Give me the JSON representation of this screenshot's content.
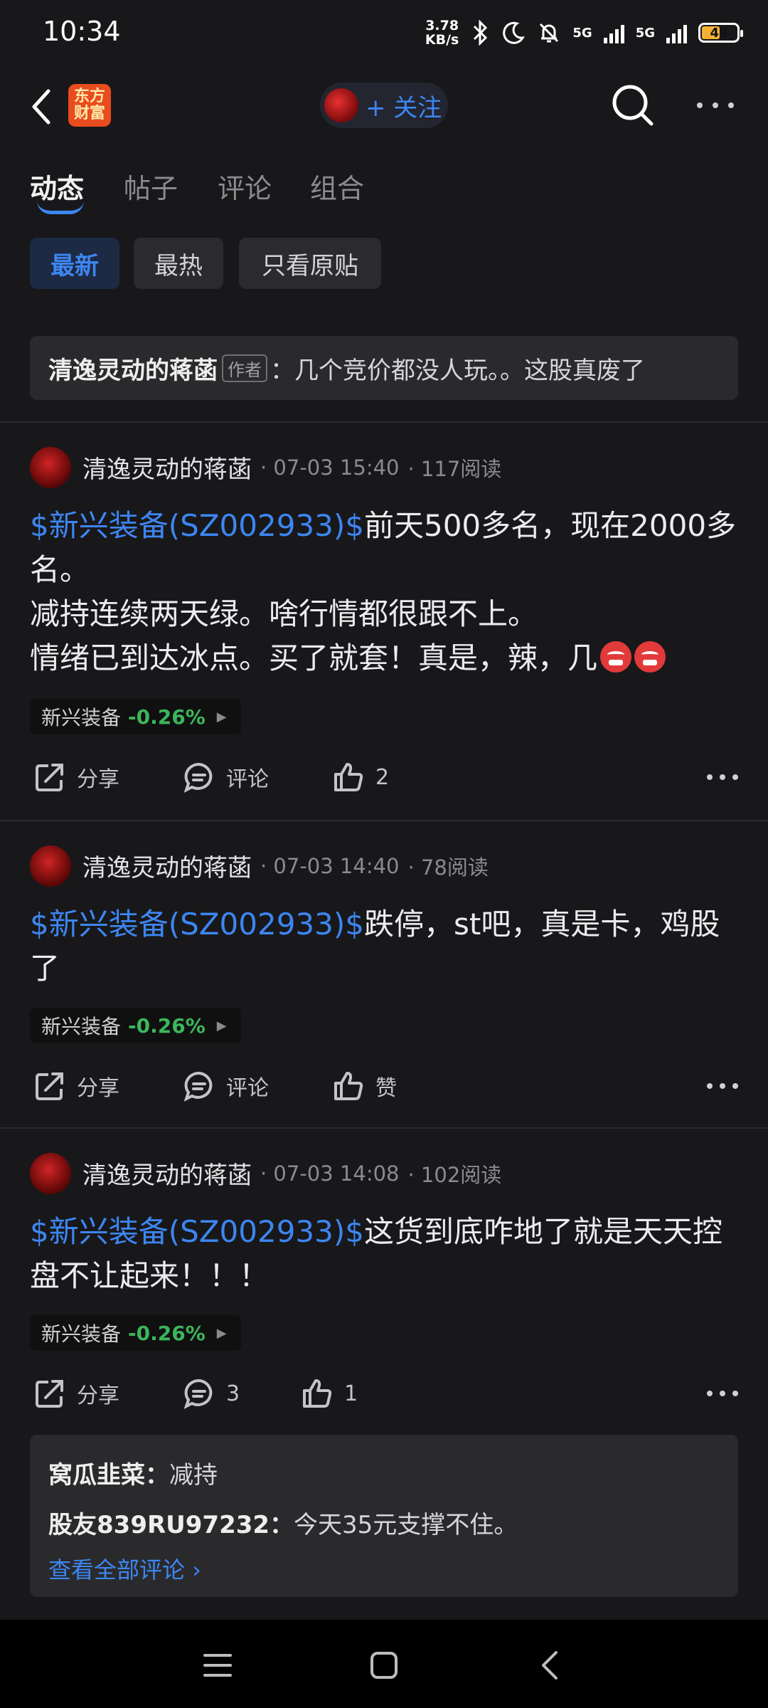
{
  "status_bar": {
    "time": "10:34",
    "net_speed_value": "3.78",
    "net_speed_unit": "KB/s",
    "network_1": "5G",
    "network_2": "5G",
    "battery": "49"
  },
  "header": {
    "logo_text": "东方财富",
    "follow_label": "+ 关注"
  },
  "tabs": [
    {
      "label": "动态",
      "active": true
    },
    {
      "label": "帖子",
      "active": false
    },
    {
      "label": "评论",
      "active": false
    },
    {
      "label": "组合",
      "active": false
    }
  ],
  "filters": [
    {
      "label": "最新",
      "active": true
    },
    {
      "label": "最热",
      "active": false
    },
    {
      "label": "只看原贴",
      "active": false
    }
  ],
  "top_comment": {
    "author": "清逸灵动的蒋菡",
    "author_tag": "作者",
    "sep": "：",
    "text": "几个竞价都没人玩。。这股真废了"
  },
  "posts": [
    {
      "author": "清逸灵动的蒋菡",
      "time": "· 07-03 15:40",
      "reads": "· 117阅读",
      "stock_link": "$新兴装备(SZ002933)$",
      "text": "前天500多名，现在2000多名。",
      "line2": "减持连续两天绿。啥行情都很跟不上。",
      "line3": "情绪已到达冰点。买了就套！真是，辣，几",
      "tag_name": "新兴装备",
      "tag_change": "-0.26%",
      "share": "分享",
      "comment": "评论",
      "like": "2"
    },
    {
      "author": "清逸灵动的蒋菡",
      "time": "· 07-03 14:40",
      "reads": "· 78阅读",
      "stock_link": "$新兴装备(SZ002933)$",
      "text": "跌停，st吧，真是卡，鸡股了",
      "tag_name": "新兴装备",
      "tag_change": "-0.26%",
      "share": "分享",
      "comment": "评论",
      "like": "赞"
    },
    {
      "author": "清逸灵动的蒋菡",
      "time": "· 07-03 14:08",
      "reads": "· 102阅读",
      "stock_link": "$新兴装备(SZ002933)$",
      "text": "这货到底咋地了就是天天控盘不让起来！！！",
      "tag_name": "新兴装备",
      "tag_change": "-0.26%",
      "share": "分享",
      "comment": "3",
      "like": "1"
    }
  ],
  "comments": [
    {
      "user": "窝瓜韭菜：",
      "text": "减持"
    },
    {
      "user": "股友839RU97232：",
      "text": "今天35元支撑不住。"
    }
  ],
  "view_all": "查看全部评论 ›",
  "colors": {
    "accent": "#3d86f2",
    "down": "#3cb65a",
    "background": "#18181a"
  }
}
